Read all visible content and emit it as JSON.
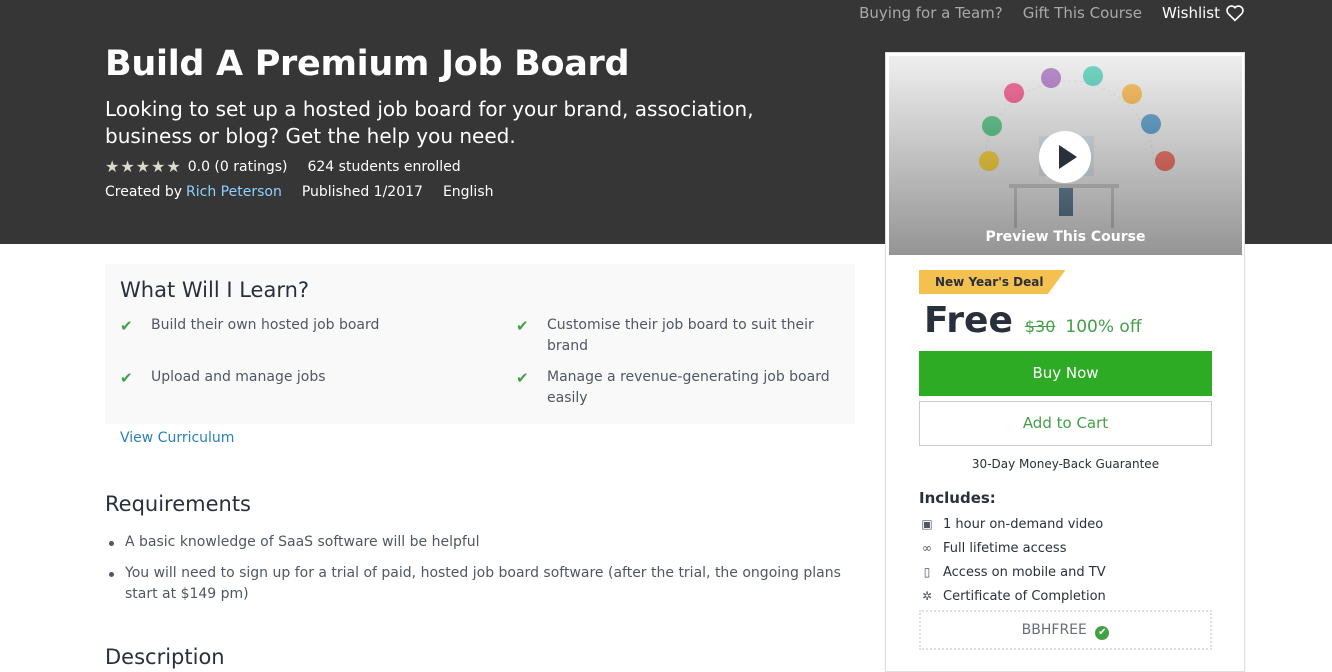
{
  "header": {
    "links": [
      "Buying for a Team?",
      "Gift This Course"
    ],
    "wishlist_label": "Wishlist",
    "title": "Build A Premium Job Board",
    "subtitle": "Looking to set up a hosted job board for your brand, association, business or blog? Get the help you need.",
    "rating": "0.0 (0 ratings)",
    "stars": 5,
    "enrolled": "624 students enrolled",
    "created_by_label": "Created by",
    "author": "Rich Peterson",
    "published": "Published 1/2017",
    "language": "English"
  },
  "learn": {
    "heading": "What Will I Learn?",
    "items": [
      "Build their own hosted job board",
      "Customise their job board to suit their brand",
      "Upload and manage jobs",
      "Manage a revenue-generating job board easily"
    ],
    "view_curriculum": "View Curriculum"
  },
  "requirements": {
    "heading": "Requirements",
    "items": [
      "A basic knowledge of SaaS software will be helpful",
      "You will need to sign up for a trial of paid, hosted job board software (after the trial, the ongoing plans start at $149 pm)"
    ]
  },
  "description": {
    "heading": "Description"
  },
  "sidebar": {
    "preview_label": "Preview This Course",
    "deal_badge": "New Year's Deal",
    "price": "Free",
    "original_price": "$30",
    "discount": "100% off",
    "buy_now": "Buy Now",
    "add_to_cart": "Add to Cart",
    "guarantee": "30-Day Money-Back Guarantee",
    "includes_heading": "Includes:",
    "includes": [
      {
        "icon": "video-icon",
        "label": "1 hour on-demand video"
      },
      {
        "icon": "infinity-icon",
        "label": "Full lifetime access"
      },
      {
        "icon": "mobile-icon",
        "label": "Access on mobile and TV"
      },
      {
        "icon": "certificate-icon",
        "label": "Certificate of Completion"
      }
    ],
    "coupon": "BBHFREE"
  },
  "colors": {
    "hero_bg": "#363636",
    "accent_green": "#43a047",
    "buy_button": "#2dab24",
    "deal_badge": "#f4c150",
    "author_link": "#8fd0ff"
  }
}
